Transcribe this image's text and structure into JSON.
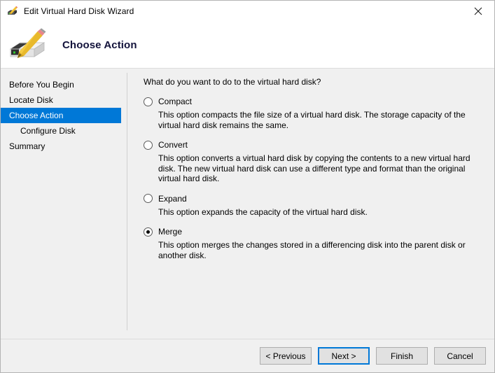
{
  "window": {
    "title": "Edit Virtual Hard Disk Wizard",
    "title_icon": "vhd-pencil-icon",
    "close_icon": "close-icon"
  },
  "header": {
    "title": "Choose Action",
    "icon": "vhd-pencil-large-icon"
  },
  "sidebar": {
    "items": [
      {
        "label": "Before You Begin",
        "selected": false,
        "sub": false
      },
      {
        "label": "Locate Disk",
        "selected": false,
        "sub": false
      },
      {
        "label": "Choose Action",
        "selected": true,
        "sub": false
      },
      {
        "label": "Configure Disk",
        "selected": false,
        "sub": true
      },
      {
        "label": "Summary",
        "selected": false,
        "sub": false
      }
    ],
    "selected_color": "#0078d7"
  },
  "main": {
    "question": "What do you want to do to the virtual hard disk?",
    "options": [
      {
        "label": "Compact",
        "checked": false,
        "description": "This option compacts the file size of a virtual hard disk. The storage capacity of the virtual hard disk remains the same."
      },
      {
        "label": "Convert",
        "checked": false,
        "description": "This option converts a virtual hard disk by copying the contents to a new virtual hard disk. The new virtual hard disk can use a different type and format than the original virtual hard disk."
      },
      {
        "label": "Expand",
        "checked": false,
        "description": "This option expands the capacity of the virtual hard disk."
      },
      {
        "label": "Merge",
        "checked": true,
        "description": "This option merges the changes stored in a differencing disk into the parent disk or another disk."
      }
    ]
  },
  "footer": {
    "buttons": [
      {
        "label": "< Previous",
        "focused": false
      },
      {
        "label": "Next >",
        "focused": true
      },
      {
        "label": "Finish",
        "focused": false
      },
      {
        "label": "Cancel",
        "focused": false
      }
    ],
    "focus_color": "#0078d7"
  }
}
